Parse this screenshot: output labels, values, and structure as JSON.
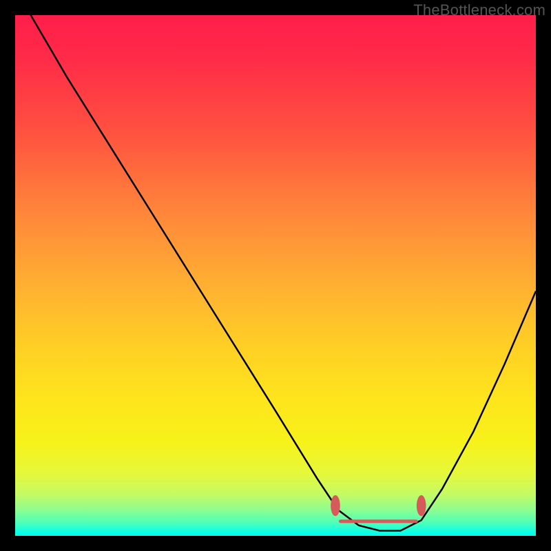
{
  "watermark": "TheBottleneck.com",
  "chart_data": {
    "type": "line",
    "title": "",
    "xlabel": "",
    "ylabel": "",
    "xlim": [
      0,
      100
    ],
    "ylim": [
      0,
      100
    ],
    "grid": false,
    "legend": false,
    "series": [
      {
        "name": "bottleneck-curve",
        "x": [
          3,
          10,
          20,
          30,
          40,
          50,
          58,
          62,
          66,
          70,
          74,
          78,
          82,
          88,
          94,
          100
        ],
        "y": [
          100,
          88,
          72,
          56,
          40,
          24,
          11,
          5,
          2,
          1,
          1,
          3,
          9,
          20,
          33,
          47
        ],
        "color": "#000000",
        "stroke_width": 2.5
      }
    ],
    "markers": [
      {
        "name": "optimal-range-left",
        "shape": "ellipse",
        "cx": 61.5,
        "cy": 5.8,
        "rx": 0.9,
        "ry": 2.0,
        "fill": "#d65a5a"
      },
      {
        "name": "optimal-range-right",
        "shape": "ellipse",
        "cx": 78.0,
        "cy": 5.8,
        "rx": 0.9,
        "ry": 2.0,
        "fill": "#d65a5a"
      },
      {
        "name": "optimal-range-band",
        "shape": "line",
        "x1": 62.5,
        "y1": 2.8,
        "x2": 77.0,
        "y2": 2.8,
        "stroke": "#d65a5a",
        "stroke_width": 5
      }
    ],
    "background_gradient": {
      "direction": "vertical",
      "stops": [
        {
          "pos": 0.0,
          "color": "#ff1e4a"
        },
        {
          "pos": 0.22,
          "color": "#ff5040"
        },
        {
          "pos": 0.52,
          "color": "#ffb032"
        },
        {
          "pos": 0.74,
          "color": "#fde51c"
        },
        {
          "pos": 0.92,
          "color": "#c4fb64"
        },
        {
          "pos": 1.0,
          "color": "#00ffef"
        }
      ]
    }
  }
}
